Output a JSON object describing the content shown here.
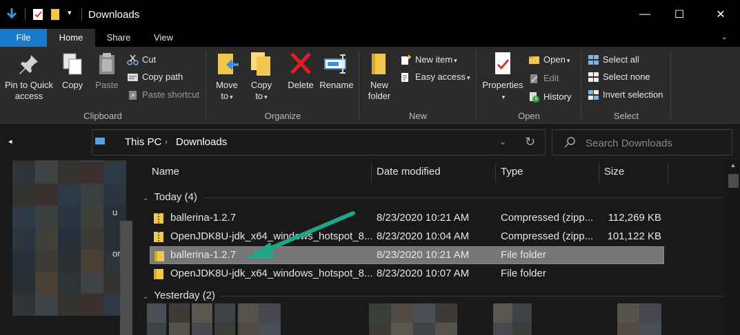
{
  "window": {
    "title": "Downloads",
    "minimize_glyph": "—",
    "maximize_glyph": "☐",
    "close_glyph": "✕",
    "qat_dropdown_glyph": "▾"
  },
  "tabs": [
    {
      "label": "File"
    },
    {
      "label": "Home"
    },
    {
      "label": "Share"
    },
    {
      "label": "View"
    }
  ],
  "ribbon_toggle_glyph": "⌄",
  "ribbon": {
    "clipboard": {
      "label": "Clipboard",
      "pin_line1": "Pin to Quick",
      "pin_line2": "access",
      "copy": "Copy",
      "paste": "Paste",
      "cut": "Cut",
      "copy_path": "Copy path",
      "paste_shortcut": "Paste shortcut"
    },
    "organize": {
      "label": "Organize",
      "move_line1": "Move",
      "move_line2": "to",
      "copy_line1": "Copy",
      "copy_line2": "to",
      "delete": "Delete",
      "rename": "Rename"
    },
    "new": {
      "label": "New",
      "new_folder_line1": "New",
      "new_folder_line2": "folder",
      "new_item": "New item",
      "easy_access": "Easy access"
    },
    "open": {
      "label": "Open",
      "properties": "Properties",
      "open": "Open",
      "edit": "Edit",
      "history": "History"
    },
    "select": {
      "label": "Select",
      "select_all": "Select all",
      "select_none": "Select none",
      "invert_selection": "Invert selection"
    },
    "caret": "▾"
  },
  "address": {
    "crumbs": [
      "This PC",
      "Downloads"
    ],
    "separator": "›",
    "dropdown_glyph": "⌄",
    "refresh_glyph": "↻"
  },
  "search": {
    "placeholder": "Search Downloads"
  },
  "navpane": {
    "back_glyph": "◂",
    "letter_u": "u",
    "letter_on": "on",
    "scroll_up": "▲"
  },
  "columns": {
    "name": "Name",
    "date": "Date modified",
    "type": "Type",
    "size": "Size"
  },
  "groups": [
    {
      "label": "Today (4)",
      "chevron": "⌄",
      "files": [
        {
          "name": "ballerina-1.2.7",
          "date": "8/23/2020 10:21 AM",
          "type": "Compressed (zipp...",
          "size": "112,269 KB",
          "kind": "zip"
        },
        {
          "name": "OpenJDK8U-jdk_x64_windows_hotspot_8...",
          "date": "8/23/2020 10:04 AM",
          "type": "Compressed (zipp...",
          "size": "101,122 KB",
          "kind": "zip"
        },
        {
          "name": "ballerina-1.2.7",
          "date": "8/23/2020 10:21 AM",
          "type": "File folder",
          "size": "",
          "kind": "folder",
          "selected": true
        },
        {
          "name": "OpenJDK8U-jdk_x64_windows_hotspot_8...",
          "date": "8/23/2020 10:07 AM",
          "type": "File folder",
          "size": "",
          "kind": "folder"
        }
      ]
    },
    {
      "label": "Yesterday (2)",
      "chevron": "⌄",
      "files": []
    }
  ],
  "colors": {
    "accent": "#1979ca",
    "annotation_arrow": "#1fa58a",
    "folder": "#f3c74e"
  }
}
